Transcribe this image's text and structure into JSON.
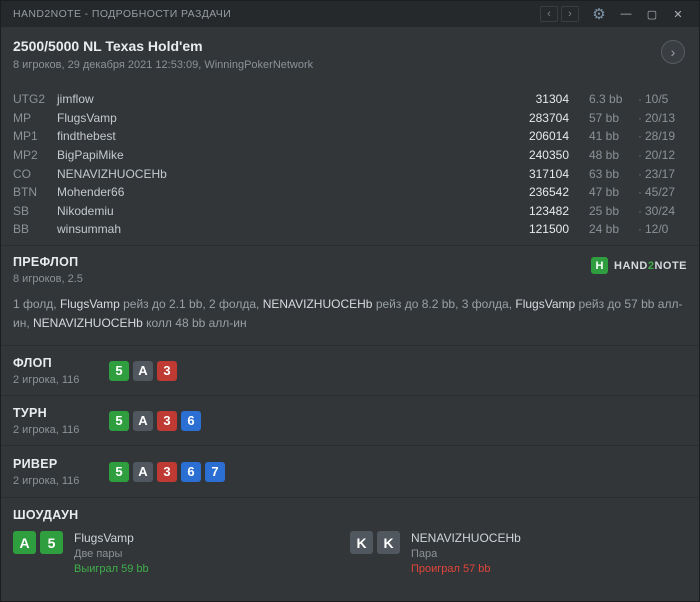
{
  "misc": {
    "dot": "·"
  },
  "icons": {
    "back": "‹",
    "forward": "›",
    "gear": "⚙",
    "minimize": "—",
    "maximize": "▢",
    "close": "✕",
    "expand": "›"
  },
  "titlebar": {
    "title": "HAND2NOTE - ПОДРОБНОСТИ РАЗДАЧИ"
  },
  "header": {
    "title": "2500/5000 NL Texas Hold'em",
    "subtitle": "8 игроков, 29 декабря 2021 12:53:09, WinningPokerNetwork"
  },
  "players": [
    {
      "pos": "UTG2",
      "name": "jimflow",
      "stack": "31304",
      "bb": "6.3 bb",
      "stats": "10/5"
    },
    {
      "pos": "MP",
      "name": "FlugsVamp",
      "stack": "283704",
      "bb": "57 bb",
      "stats": "20/13"
    },
    {
      "pos": "MP1",
      "name": "findthebest",
      "stack": "206014",
      "bb": "41 bb",
      "stats": "28/19"
    },
    {
      "pos": "MP2",
      "name": "BigPapiMike",
      "stack": "240350",
      "bb": "48 bb",
      "stats": "20/12"
    },
    {
      "pos": "CO",
      "name": "NENAVIZHUOCEHb",
      "stack": "317104",
      "bb": "63 bb",
      "stats": "23/17"
    },
    {
      "pos": "BTN",
      "name": "Mohender66",
      "stack": "236542",
      "bb": "47 bb",
      "stats": "45/27"
    },
    {
      "pos": "SB",
      "name": "Nikodemiu",
      "stack": "123482",
      "bb": "25 bb",
      "stats": "30/24"
    },
    {
      "pos": "BB",
      "name": "winsummah",
      "stack": "121500",
      "bb": "24 bb",
      "stats": "12/0"
    }
  ],
  "preflop": {
    "title": "ПРЕФЛОП",
    "subtitle": "8 игроков, 2.5",
    "logo": {
      "icon": "H",
      "part1": "HAND",
      "part2": "2",
      "part3": "NOTE"
    },
    "action": [
      {
        "text": "1 фолд, ",
        "hl": "no"
      },
      {
        "text": "FlugsVamp",
        "hl": "yes"
      },
      {
        "text": " рейз до 2.1 bb, 2 фолда, ",
        "hl": "no"
      },
      {
        "text": "NENAVIZHUOCEHb",
        "hl": "yes"
      },
      {
        "text": " рейз до 8.2 bb, 3 фолда, ",
        "hl": "no"
      },
      {
        "text": "FlugsVamp",
        "hl": "yes"
      },
      {
        "text": " рейз до 57 bb алл-ин, ",
        "hl": "no"
      },
      {
        "text": "NENAVIZHUOCEHb",
        "hl": "yes"
      },
      {
        "text": " колл 48 bb алл-ин",
        "hl": "no"
      }
    ]
  },
  "flop": {
    "title": "ФЛОП",
    "subtitle": "2 игрока, 116",
    "cards": [
      {
        "rank": "5",
        "suit": "clubs"
      },
      {
        "rank": "A",
        "suit": "spades"
      },
      {
        "rank": "3",
        "suit": "hearts"
      }
    ]
  },
  "turn": {
    "title": "ТУРН",
    "subtitle": "2 игрока, 116",
    "cards": [
      {
        "rank": "5",
        "suit": "clubs"
      },
      {
        "rank": "A",
        "suit": "spades"
      },
      {
        "rank": "3",
        "suit": "hearts"
      },
      {
        "rank": "6",
        "suit": "diamonds"
      }
    ]
  },
  "river": {
    "title": "РИВЕР",
    "subtitle": "2 игрока, 116",
    "cards": [
      {
        "rank": "5",
        "suit": "clubs"
      },
      {
        "rank": "A",
        "suit": "spades"
      },
      {
        "rank": "3",
        "suit": "hearts"
      },
      {
        "rank": "6",
        "suit": "diamonds"
      },
      {
        "rank": "7",
        "suit": "diamonds"
      }
    ]
  },
  "showdown": {
    "title": "ШОУДАУН",
    "left": {
      "cards": [
        {
          "rank": "A",
          "suit": "clubs"
        },
        {
          "rank": "5",
          "suit": "clubs"
        }
      ],
      "name": "FlugsVamp",
      "combo": "Две пары",
      "result": "Выиграл 59 bb",
      "outcome": "win"
    },
    "right": {
      "cards": [
        {
          "rank": "K",
          "suit": "spades"
        },
        {
          "rank": "K",
          "suit": "spades"
        }
      ],
      "name": "NENAVIZHUOCEHb",
      "combo": "Пара",
      "result": "Проиграл 57 bb",
      "outcome": "loss"
    }
  }
}
